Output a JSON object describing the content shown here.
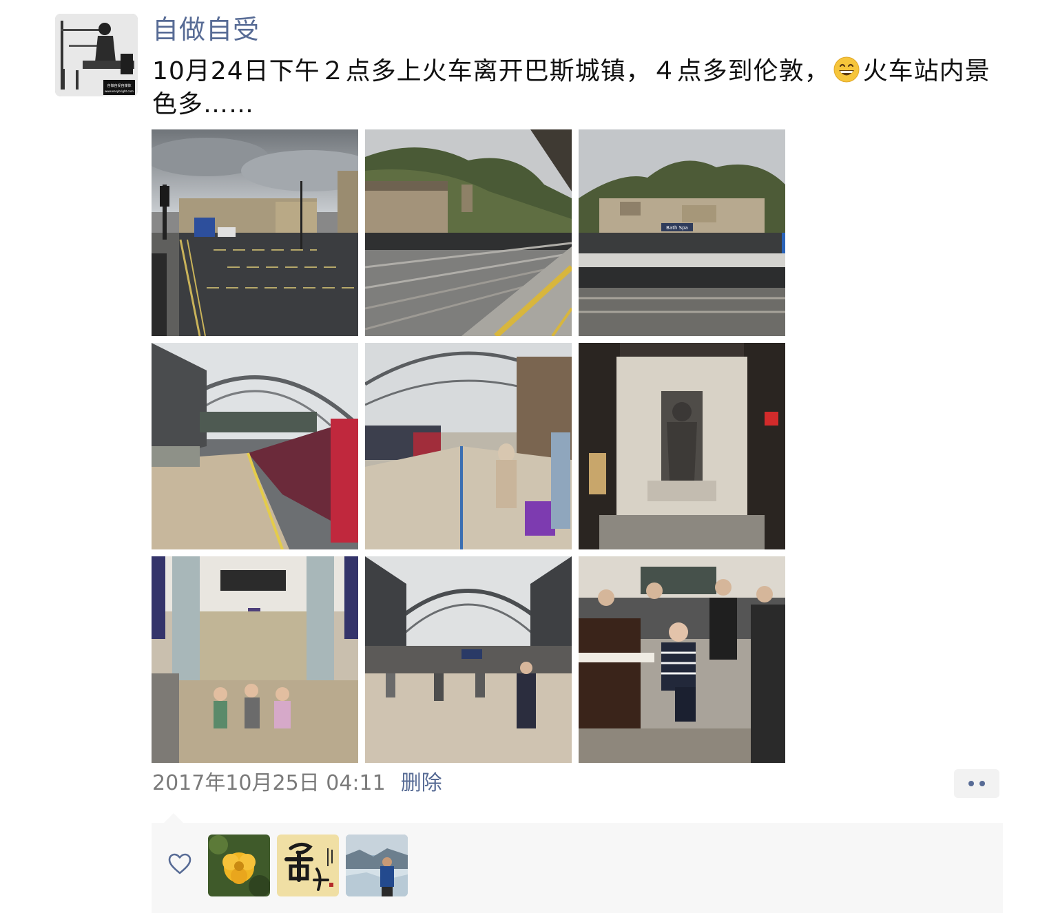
{
  "user": {
    "name": "自做自受"
  },
  "post": {
    "text_part1": "10月24日下午２点多上火车离开巴斯城镇，４点多到伦敦，",
    "emoji_icon": "grinning-face-emoji",
    "text_part2": "火车站内景色多……"
  },
  "photos": [
    {
      "name": "street-photo",
      "subject": "Bath street with bus and traffic lights"
    },
    {
      "name": "platform-photo",
      "subject": "Bath Spa platform with tracks"
    },
    {
      "name": "station-sign-photo",
      "subject": "Bath Spa station sign and hillside"
    },
    {
      "name": "paddington-train-photo",
      "subject": "Paddington platform with red train"
    },
    {
      "name": "paddington-platform-photo",
      "subject": "Paddington concourse with travellers"
    },
    {
      "name": "war-memorial-photo",
      "subject": "Statue memorial in station"
    },
    {
      "name": "children-photo",
      "subject": "Children sitting by columns"
    },
    {
      "name": "concourse-photo",
      "subject": "Paddington concourse under arched roof"
    },
    {
      "name": "piano-photo",
      "subject": "Man playing piano in crowd"
    }
  ],
  "meta": {
    "timestamp": "2017年10月25日 04:11",
    "delete_label": "删除"
  },
  "sign_text": "Bath Spa",
  "avatar_caption": "自做自受自媒体",
  "avatar_url_text": "www.easybright.com",
  "likers": [
    {
      "name": "liker-1",
      "subject": "yellow flower"
    },
    {
      "name": "liker-2",
      "subject": "calligraphy 舍得"
    },
    {
      "name": "liker-3",
      "subject": "person by glacier"
    }
  ],
  "colors": {
    "link": "#576b95",
    "meta_text": "#7a7a7a",
    "like_bg": "#f7f7f7"
  }
}
